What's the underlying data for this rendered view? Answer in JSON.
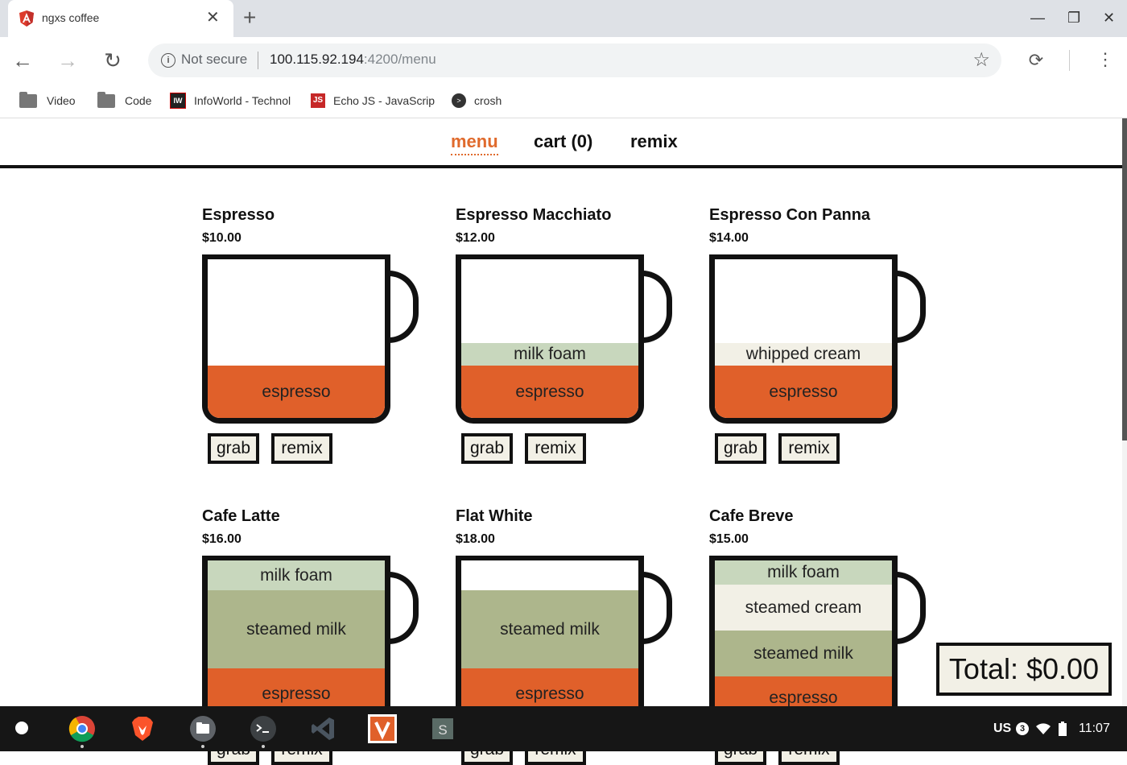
{
  "browser": {
    "tab_title": "ngxs coffee",
    "close_glyph": "✕",
    "new_tab_glyph": "+",
    "window_controls": [
      "—",
      "❐",
      "✕"
    ],
    "security_label": "Not secure",
    "url_host": "100.115.92.194",
    "url_rest": ":4200/menu",
    "bookmarks": [
      {
        "label": "Video",
        "icon": "folder-icon"
      },
      {
        "label": "Code",
        "icon": "folder-icon"
      },
      {
        "label": "InfoWorld - Technol",
        "icon": "infoworld-icon"
      },
      {
        "label": "Echo JS - JavaScrip",
        "icon": "echojs-icon"
      },
      {
        "label": "crosh",
        "icon": "crosh-icon"
      }
    ]
  },
  "app": {
    "nav": {
      "menu": "menu",
      "cart": "cart (0)",
      "remix": "remix"
    },
    "buttons": {
      "grab": "grab",
      "remix": "remix"
    },
    "items": [
      {
        "name": "Espresso",
        "price": "$10.00",
        "layers": [
          {
            "label": "espresso",
            "type": "espresso",
            "share": 0.33
          }
        ]
      },
      {
        "name": "Espresso Macchiato",
        "price": "$12.00",
        "layers": [
          {
            "label": "milk foam",
            "type": "foam",
            "share": 0.14
          },
          {
            "label": "espresso",
            "type": "espresso",
            "share": 0.33
          }
        ]
      },
      {
        "name": "Espresso Con Panna",
        "price": "$14.00",
        "layers": [
          {
            "label": "whipped cream",
            "type": "cream",
            "share": 0.14
          },
          {
            "label": "espresso",
            "type": "espresso",
            "share": 0.33
          }
        ]
      },
      {
        "name": "Cafe Latte",
        "price": "$16.00",
        "layers": [
          {
            "label": "milk foam",
            "type": "foam",
            "share": 0.19
          },
          {
            "label": "steamed milk",
            "type": "steamed",
            "share": 0.49
          },
          {
            "label": "espresso",
            "type": "espresso",
            "share": 0.32
          }
        ]
      },
      {
        "name": "Flat White",
        "price": "$18.00",
        "layers": [
          {
            "label": "steamed milk",
            "type": "steamed",
            "share": 0.49
          },
          {
            "label": "espresso",
            "type": "espresso",
            "share": 0.32
          }
        ]
      },
      {
        "name": "Cafe Breve",
        "price": "$15.00",
        "layers": [
          {
            "label": "milk foam",
            "type": "foam",
            "share": 0.15
          },
          {
            "label": "steamed cream",
            "type": "cream",
            "share": 0.29
          },
          {
            "label": "steamed milk",
            "type": "steamed",
            "share": 0.29
          },
          {
            "label": "espresso",
            "type": "espresso",
            "share": 0.27
          }
        ]
      }
    ],
    "total": "Total: $0.00"
  },
  "shelf": {
    "apps": [
      "chrome-icon",
      "brave-icon",
      "files-icon",
      "terminal-icon",
      "vscode-icon",
      "vivaldi-icon",
      "sublime-icon"
    ],
    "locale": "US",
    "notification_count": "3",
    "time": "11:07"
  },
  "colors": {
    "accent": "#e06a2c",
    "espresso": "#e0602a",
    "milk_foam": "#c8d7bd",
    "steamed_milk": "#adb68c",
    "cream": "#f2f0e6"
  }
}
